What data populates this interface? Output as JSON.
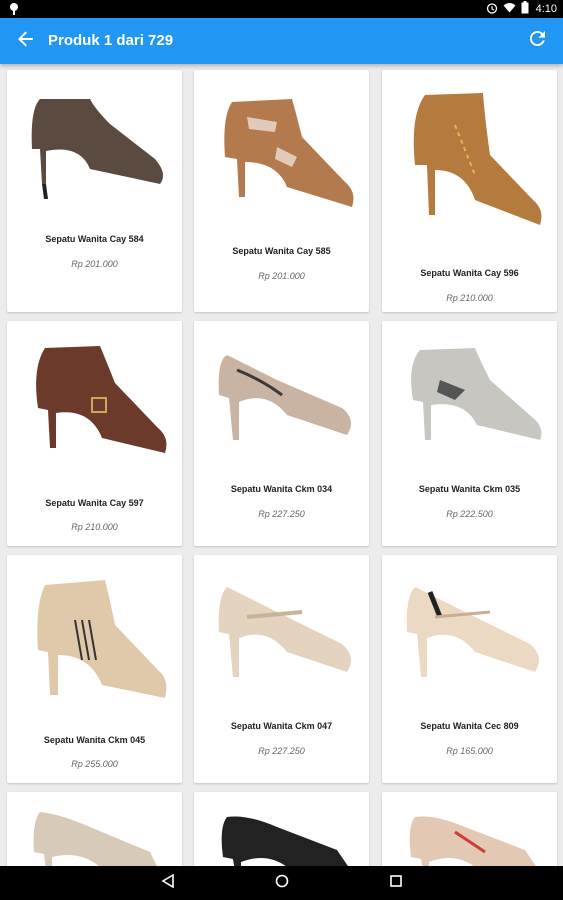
{
  "status_bar": {
    "time": "4:10",
    "icons": [
      "notification-icon",
      "alarm-icon",
      "wifi-icon",
      "battery-icon"
    ]
  },
  "app_bar": {
    "title": "Produk 1 dari 729",
    "back_icon": "arrow-back-icon",
    "refresh_icon": "refresh-icon",
    "color": "#2196f3"
  },
  "products": [
    {
      "name": "Sepatu Wanita Cay 584",
      "price": "Rp 201.000",
      "color": "#5a4a40"
    },
    {
      "name": "Sepatu Wanita Cay 585",
      "price": "Rp 201.000",
      "color": "#b37a4e"
    },
    {
      "name": "Sepatu Wanita Cay 596",
      "price": "Rp 210.000",
      "color": "#b47a3e"
    },
    {
      "name": "Sepatu Wanita Cay 597",
      "price": "Rp 210.000",
      "color": "#6b3a2a"
    },
    {
      "name": "Sepatu Wanita Ckm 034",
      "price": "Rp 227.250",
      "color": "#c9b3a3"
    },
    {
      "name": "Sepatu Wanita Ckm 035",
      "price": "Rp 222.500",
      "color": "#c8c6c0"
    },
    {
      "name": "Sepatu Wanita Ckm 045",
      "price": "Rp 255.000",
      "color": "#e0c9ab"
    },
    {
      "name": "Sepatu Wanita Ckm 047",
      "price": "Rp 227.250",
      "color": "#e3d3bf"
    },
    {
      "name": "Sepatu Wanita Cec 809",
      "price": "Rp 165.000",
      "color": "#ecd9c4"
    },
    {
      "name": "",
      "price": "",
      "color": "#d8cab9"
    },
    {
      "name": "",
      "price": "",
      "color": "#222222"
    },
    {
      "name": "",
      "price": "",
      "color": "#e3c9b4"
    }
  ],
  "nav_bar": {
    "back_icon": "nav-back-icon",
    "home_icon": "nav-home-icon",
    "recents_icon": "nav-recents-icon"
  }
}
